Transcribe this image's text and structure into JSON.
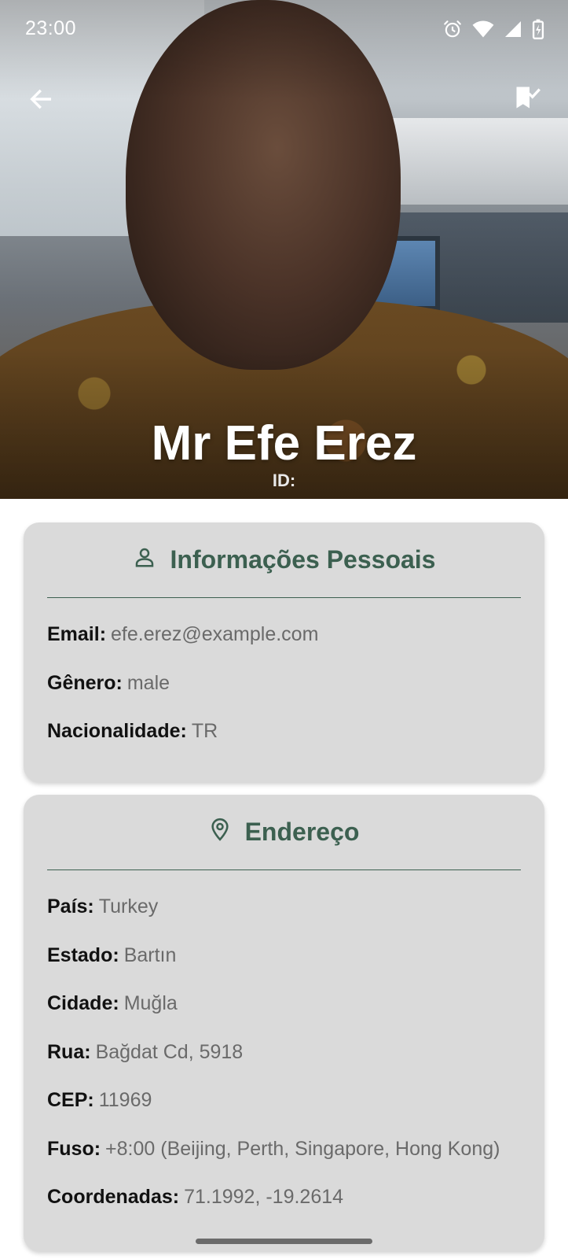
{
  "status_bar": {
    "time": "23:00",
    "icons": [
      "alarm-icon",
      "wifi-icon",
      "signal-icon",
      "battery-charging-icon"
    ]
  },
  "header": {
    "back_icon": "arrow-left-icon",
    "bookmark_icon": "bookmark-check-icon"
  },
  "profile": {
    "name": "Mr Efe Erez",
    "id_label": "ID:"
  },
  "personal_info": {
    "title": "Informações Pessoais",
    "icon": "person-icon",
    "rows": [
      {
        "label": "Email:",
        "value": "efe.erez@example.com"
      },
      {
        "label": "Gênero:",
        "value": "male"
      },
      {
        "label": "Nacionalidade:",
        "value": "TR"
      }
    ]
  },
  "address": {
    "title": "Endereço",
    "icon": "location-pin-icon",
    "rows": [
      {
        "label": "País:",
        "value": "Turkey"
      },
      {
        "label": "Estado:",
        "value": "Bartın"
      },
      {
        "label": "Cidade:",
        "value": "Muğla"
      },
      {
        "label": "Rua:",
        "value": "Bağdat Cd, 5918"
      },
      {
        "label": "CEP:",
        "value": "11969"
      },
      {
        "label": "Fuso:",
        "value": "+8:00 (Beijing, Perth, Singapore, Hong Kong)"
      },
      {
        "label": "Coordenadas:",
        "value": "71.1992, -19.2614"
      }
    ]
  },
  "colors": {
    "accent": "#3c6050",
    "card_bg": "#dadada",
    "value_text": "#6a6a6a"
  }
}
